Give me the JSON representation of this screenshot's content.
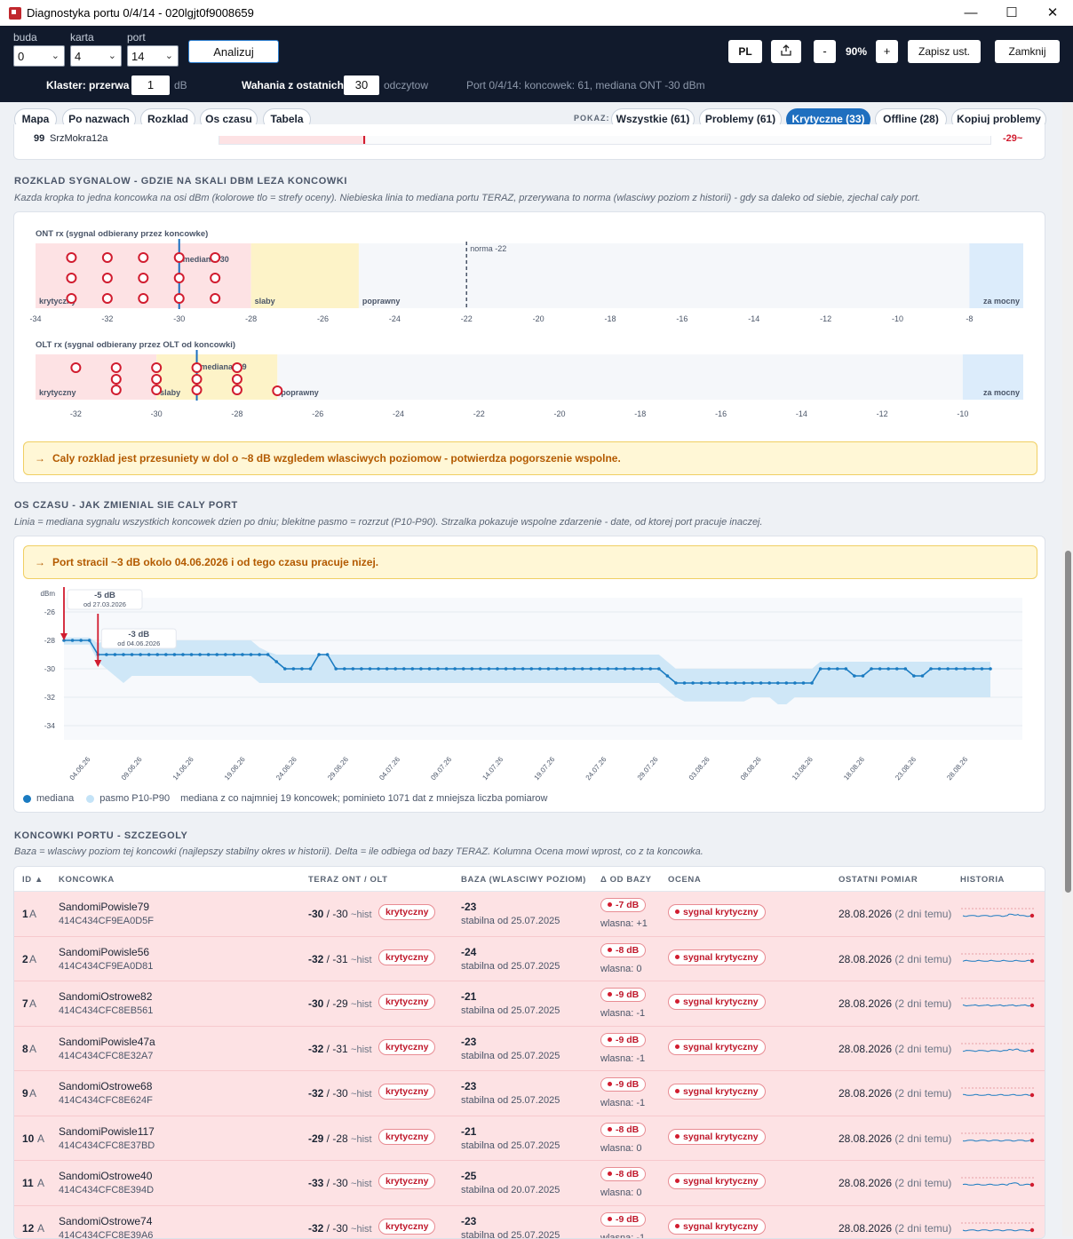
{
  "window": {
    "title": "Diagnostyka portu 0/4/14 - 020lgjt0f9008659"
  },
  "toolbar": {
    "buda_label": "buda",
    "buda_value": "0",
    "karta_label": "karta",
    "karta_value": "4",
    "port_label": "port",
    "port_value": "14",
    "analyze": "Analizuj",
    "lang": "PL",
    "zoom_minus": "-",
    "zoom": "90%",
    "zoom_plus": "+",
    "save": "Zapisz ust.",
    "close": "Zamknij",
    "cluster_label": "Klaster: przerwa",
    "cluster_value": "1",
    "cluster_unit": "dB",
    "fluct_label": "Wahania z ostatnich",
    "fluct_value": "30",
    "fluct_unit": "odczytow",
    "port_info": "Port 0/4/14: koncowek: 61, mediana ONT -30 dBm"
  },
  "tabs": [
    "Mapa",
    "Po nazwach",
    "Rozklad",
    "Os czasu",
    "Tabela"
  ],
  "filter": {
    "label": "POKAZ:",
    "all": "Wszystkie (61)",
    "problems": "Problemy (61)",
    "critical": "Krytyczne (33)",
    "offline": "Offline (28)",
    "copy": "Kopiuj problemy"
  },
  "top_partial": {
    "id": "99",
    "name": "SrzMokra12a",
    "value": "-29~"
  },
  "distribution": {
    "title": "ROZKLAD SYGNALOW - GDZIE NA SKALI DBM LEZA KONCOWKI",
    "subtitle": "Kazda kropka to jedna koncowka na osi dBm (kolorowe tlo = strefy oceny). Niebieska linia to mediana portu TERAZ, przerywana to norma (wlasciwy poziom z historii) - gdy sa daleko od siebie, zjechal caly port.",
    "ont": {
      "title": "ONT rx (sygnal odbierany przez koncowke)",
      "min": -34,
      "max": -6.5,
      "ticks": [
        -34,
        -32,
        -30,
        -28,
        -26,
        -24,
        -22,
        -20,
        -18,
        -16,
        -14,
        -12,
        -10,
        -8
      ],
      "zones": [
        {
          "from": -34,
          "to": -28,
          "label": "krytyczny",
          "color": "#fde2e4"
        },
        {
          "from": -28,
          "to": -25,
          "label": "slaby",
          "color": "#fdf3c8"
        },
        {
          "from": -25,
          "to": -8,
          "label": "poprawny",
          "color": "#f5f7fa"
        },
        {
          "from": -8,
          "to": -6.5,
          "label": "za mocny",
          "color": "#dcecfb"
        }
      ],
      "median": -30,
      "median_label": "mediana -30",
      "norm": -22,
      "norm_label": "norma -22",
      "dots": [
        {
          "x": -33,
          "rows": 3
        },
        {
          "x": -32,
          "rows": 3
        },
        {
          "x": -31,
          "rows": 3
        },
        {
          "x": -30,
          "rows": 3
        },
        {
          "x": -29,
          "rows": 3
        }
      ]
    },
    "olt": {
      "title": "OLT rx (sygnal odbierany przez OLT od koncowki)",
      "min": -33,
      "max": -8.5,
      "ticks": [
        -32,
        -30,
        -28,
        -26,
        -24,
        -22,
        -20,
        -18,
        -16,
        -14,
        -12,
        -10
      ],
      "zones": [
        {
          "from": -33,
          "to": -30,
          "label": "krytyczny",
          "color": "#fde2e4"
        },
        {
          "from": -30,
          "to": -27,
          "label": "slaby",
          "color": "#fdf3c8"
        },
        {
          "from": -27,
          "to": -10,
          "label": "poprawny",
          "color": "#f5f7fa"
        },
        {
          "from": -10,
          "to": -8.5,
          "label": "za mocny",
          "color": "#dcecfb"
        }
      ],
      "median": -29,
      "median_label": "mediana -29",
      "dots": [
        {
          "x": -32,
          "rows": 1
        },
        {
          "x": -31,
          "rows": 3
        },
        {
          "x": -30,
          "rows": 3
        },
        {
          "x": -29,
          "rows": 3
        },
        {
          "x": -28,
          "rows": 3
        },
        {
          "x": -27,
          "rows": 1
        }
      ]
    },
    "alert": "Caly rozklad jest przesuniety w dol o ~8 dB wzgledem wlasciwych poziomow - potwierdza pogorszenie wspolne."
  },
  "timeline": {
    "title": "OS CZASU - JAK ZMIENIAL SIE CALY PORT",
    "subtitle": "Linia = mediana sygnalu wszystkich koncowek dzien po dniu; blekitne pasmo = rozrzut (P10-P90). Strzalka pokazuje wspolne zdarzenie - date, od ktorej port pracuje inaczej.",
    "alert": "Port stracil ~3 dB okolo 04.06.2026 i od tego czasu pracuje nizej.",
    "chart_data": {
      "type": "line",
      "ylabel": "dBm",
      "ylim": [
        -35,
        -25
      ],
      "yticks": [
        -26,
        -28,
        -30,
        -32,
        -34
      ],
      "xticks": [
        "04.06.26",
        "09.06.26",
        "14.06.26",
        "19.06.26",
        "24.06.26",
        "29.06.26",
        "04.07.26",
        "09.07.26",
        "14.07.26",
        "19.07.26",
        "24.07.26",
        "29.07.26",
        "03.08.26",
        "08.08.26",
        "13.08.26",
        "18.08.26",
        "23.08.26",
        "28.08.26"
      ],
      "median": [
        -28,
        -28,
        -28,
        -28,
        -29,
        -29,
        -29,
        -29,
        -29,
        -29,
        -29,
        -29,
        -29,
        -29,
        -29,
        -29,
        -29,
        -29,
        -29,
        -29,
        -29,
        -29,
        -29,
        -29,
        -29,
        -29.5,
        -30,
        -30,
        -30,
        -30,
        -29,
        -29,
        -30,
        -30,
        -30,
        -30,
        -30,
        -30,
        -30,
        -30,
        -30,
        -30,
        -30,
        -30,
        -30,
        -30,
        -30,
        -30,
        -30,
        -30,
        -30,
        -30,
        -30,
        -30,
        -30,
        -30,
        -30,
        -30,
        -30,
        -30,
        -30,
        -30,
        -30,
        -30,
        -30,
        -30,
        -30,
        -30,
        -30,
        -30,
        -30,
        -30.5,
        -31,
        -31,
        -31,
        -31,
        -31,
        -31,
        -31,
        -31,
        -31,
        -31,
        -31,
        -31,
        -31,
        -31,
        -31,
        -31,
        -31,
        -30,
        -30,
        -30,
        -30,
        -30.5,
        -30.5,
        -30,
        -30,
        -30,
        -30,
        -30,
        -30.5,
        -30.5,
        -30,
        -30,
        -30,
        -30,
        -30,
        -30,
        -30,
        -30
      ],
      "p10": [
        -28.3,
        -28.3,
        -28.3,
        -28.3,
        -29.5,
        -30,
        -30.5,
        -31,
        -30.5,
        -30.5,
        -30.5,
        -30.5,
        -30.5,
        -30.5,
        -30.5,
        -30.5,
        -30.5,
        -30.5,
        -30.5,
        -30.5,
        -30.5,
        -30.5,
        -30.5,
        -31,
        -31,
        -31,
        -31,
        -31,
        -31,
        -31,
        -31,
        -31,
        -31,
        -31,
        -31,
        -31,
        -31,
        -31,
        -31,
        -31,
        -31,
        -31,
        -31,
        -31,
        -31,
        -31,
        -31,
        -31,
        -31,
        -31,
        -31,
        -31,
        -31,
        -31,
        -31,
        -31,
        -31,
        -31,
        -31,
        -31,
        -31,
        -31,
        -31,
        -31,
        -31,
        -31,
        -31,
        -31,
        -31,
        -31,
        -31,
        -31.5,
        -32,
        -32.3,
        -32.3,
        -32.3,
        -32.3,
        -32.3,
        -32.3,
        -32.3,
        -32.3,
        -32,
        -32,
        -32,
        -32.5,
        -32.5,
        -32,
        -32,
        -32,
        -32,
        -32,
        -32,
        -32,
        -32,
        -32,
        -32,
        -32,
        -32,
        -32,
        -32,
        -32,
        -32,
        -32,
        -32,
        -32,
        -32,
        -32,
        -32,
        -32,
        -32
      ],
      "p90": [
        -27.8,
        -27.8,
        -27.8,
        -27.8,
        -28.2,
        -28,
        -28,
        -28,
        -28,
        -28,
        -28,
        -28,
        -28,
        -28,
        -28,
        -28,
        -28,
        -28,
        -28,
        -28,
        -28,
        -28,
        -28,
        -28.5,
        -28.8,
        -29,
        -29,
        -29,
        -29,
        -29,
        -29,
        -29,
        -29,
        -29,
        -29,
        -29,
        -29,
        -29,
        -29,
        -29,
        -29,
        -29,
        -29,
        -29,
        -29,
        -29,
        -29,
        -29,
        -29,
        -29,
        -29,
        -29,
        -29,
        -29,
        -29,
        -29,
        -29,
        -29,
        -29,
        -29,
        -29,
        -29,
        -29,
        -29,
        -29,
        -29,
        -29,
        -29,
        -29,
        -29,
        -29,
        -29.5,
        -30,
        -30,
        -30,
        -30,
        -30,
        -30,
        -30,
        -30,
        -30,
        -30,
        -30,
        -30,
        -30,
        -30,
        -30,
        -30,
        -30,
        -29.5,
        -29.5,
        -29.5,
        -29.5,
        -29.5,
        -29.5,
        -29.5,
        -29.5,
        -29.5,
        -29.5,
        -29.5,
        -29.5,
        -29.5,
        -29.5,
        -29.5,
        -29.5,
        -29.5,
        -29.5,
        -29.5,
        -29.5,
        -29.5
      ],
      "events": [
        {
          "label": "-5 dB",
          "sub": "od 27.03.2026",
          "index": 0
        },
        {
          "label": "-3 dB",
          "sub": "od 04.06.2026",
          "index": 4
        }
      ]
    },
    "legend": {
      "median": "mediana",
      "band": "pasmo P10-P90",
      "note": "mediana z co najmniej 19 koncowek; pominieto 1071 dat z mniejsza liczba pomiarow"
    }
  },
  "details": {
    "title": "KONCOWKI PORTU - SZCZEGOLY",
    "subtitle": "Baza = wlasciwy poziom tej koncowki (najlepszy stabilny okres w historii). Delta = ile odbiega od bazy TERAZ. Kolumna Ocena mowi wprost, co z ta koncowka.",
    "columns": {
      "id": "ID ▲",
      "name": "KONCOWKA",
      "now": "TERAZ ONT / OLT",
      "base": "BAZA (WLASCIWY POZIOM)",
      "delta": "Δ OD BAZY",
      "rating": "OCENA",
      "last": "OSTATNI POMIAR",
      "hist": "HISTORIA"
    },
    "rows": [
      {
        "id": "1",
        "t": "A",
        "name": "SandomiPowisle79",
        "serial": "414C434CF9EA0D5F",
        "ont": "-30",
        "olt": "-30",
        "hist": "~hist",
        "status": "krytyczny",
        "base": "-23",
        "since": "stabilna od 25.07.2025",
        "delta": "-7 dB",
        "own": "wlasna: +1",
        "rating": "sygnal krytyczny",
        "date": "28.08.2026",
        "ago": "(2 dni temu)"
      },
      {
        "id": "2",
        "t": "A",
        "name": "SandomiPowisle56",
        "serial": "414C434CF9EA0D81",
        "ont": "-32",
        "olt": "-31",
        "hist": "~hist",
        "status": "krytyczny",
        "base": "-24",
        "since": "stabilna od 25.07.2025",
        "delta": "-8 dB",
        "own": "wlasna: 0",
        "rating": "sygnal krytyczny",
        "date": "28.08.2026",
        "ago": "(2 dni temu)"
      },
      {
        "id": "7",
        "t": "A",
        "name": "SandomiOstrowe82",
        "serial": "414C434CFC8EB561",
        "ont": "-30",
        "olt": "-29",
        "hist": "~hist",
        "status": "krytyczny",
        "base": "-21",
        "since": "stabilna od 25.07.2025",
        "delta": "-9 dB",
        "own": "wlasna: -1",
        "rating": "sygnal krytyczny",
        "date": "28.08.2026",
        "ago": "(2 dni temu)"
      },
      {
        "id": "8",
        "t": "A",
        "name": "SandomiPowisle47a",
        "serial": "414C434CFC8E32A7",
        "ont": "-32",
        "olt": "-31",
        "hist": "~hist",
        "status": "krytyczny",
        "base": "-23",
        "since": "stabilna od 25.07.2025",
        "delta": "-9 dB",
        "own": "wlasna: -1",
        "rating": "sygnal krytyczny",
        "date": "28.08.2026",
        "ago": "(2 dni temu)"
      },
      {
        "id": "9",
        "t": "A",
        "name": "SandomiOstrowe68",
        "serial": "414C434CFC8E624F",
        "ont": "-32",
        "olt": "-30",
        "hist": "~hist",
        "status": "krytyczny",
        "base": "-23",
        "since": "stabilna od 25.07.2025",
        "delta": "-9 dB",
        "own": "wlasna: -1",
        "rating": "sygnal krytyczny",
        "date": "28.08.2026",
        "ago": "(2 dni temu)"
      },
      {
        "id": "10",
        "t": "A",
        "name": "SandomiPowisle117",
        "serial": "414C434CFC8E37BD",
        "ont": "-29",
        "olt": "-28",
        "hist": "~hist",
        "status": "krytyczny",
        "base": "-21",
        "since": "stabilna od 25.07.2025",
        "delta": "-8 dB",
        "own": "wlasna: 0",
        "rating": "sygnal krytyczny",
        "date": "28.08.2026",
        "ago": "(2 dni temu)"
      },
      {
        "id": "11",
        "t": "A",
        "name": "SandomiOstrowe40",
        "serial": "414C434CFC8E394D",
        "ont": "-33",
        "olt": "-30",
        "hist": "~hist",
        "status": "krytyczny",
        "base": "-25",
        "since": "stabilna od 20.07.2025",
        "delta": "-8 dB",
        "own": "wlasna: 0",
        "rating": "sygnal krytyczny",
        "date": "28.08.2026",
        "ago": "(2 dni temu)"
      },
      {
        "id": "12",
        "t": "A",
        "name": "SandomiOstrowe74",
        "serial": "414C434CFC8E39A6",
        "ont": "-32",
        "olt": "-30",
        "hist": "~hist",
        "status": "krytyczny",
        "base": "-23",
        "since": "stabilna od 25.07.2025",
        "delta": "-9 dB",
        "own": "wlasna: -1",
        "rating": "sygnal krytyczny",
        "date": "28.08.2026",
        "ago": "(2 dni temu)"
      }
    ]
  }
}
